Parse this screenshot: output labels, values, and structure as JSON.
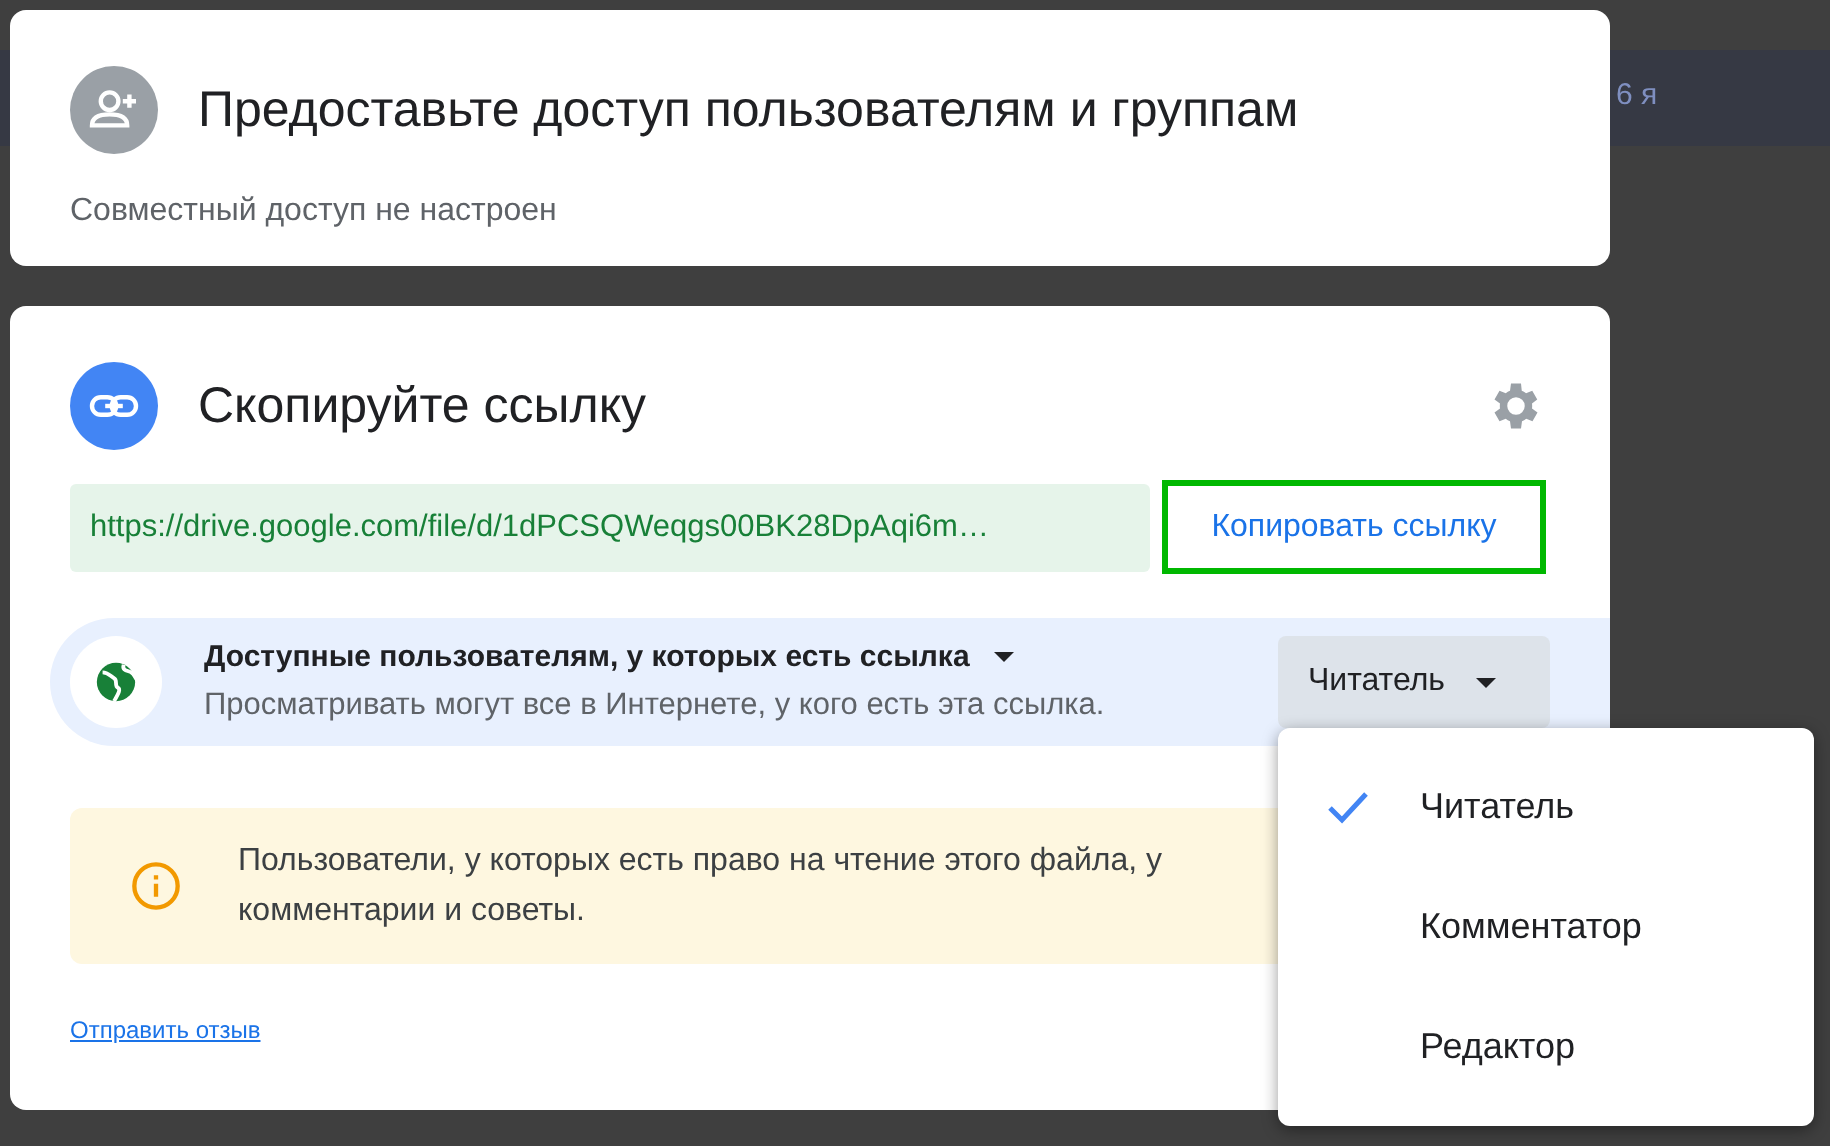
{
  "background_table": {
    "cell": "6 я"
  },
  "share_card": {
    "title": "Предоставьте доступ пользователям и группам",
    "subtitle": "Совместный доступ не настроен"
  },
  "link_card": {
    "title": "Скопируйте ссылку",
    "url": "https://drive.google.com/file/d/1dPCSQWeqgs00BK28DpAqi6m…",
    "copy_button": "Копировать ссылку",
    "access": {
      "label": "Доступные пользователям, у которых есть ссылка",
      "description": "Просматривать могут все в Интернете, у кого есть эта ссылка.",
      "role": "Читатель"
    },
    "notice": "Пользователи, у которых есть право на чтение этого файла, у\nкомментарии и советы.",
    "feedback_link": "Отправить отзыв"
  },
  "role_menu": [
    {
      "label": "Читатель",
      "selected": true
    },
    {
      "label": "Комментатор",
      "selected": false
    },
    {
      "label": "Редактор",
      "selected": false
    }
  ]
}
